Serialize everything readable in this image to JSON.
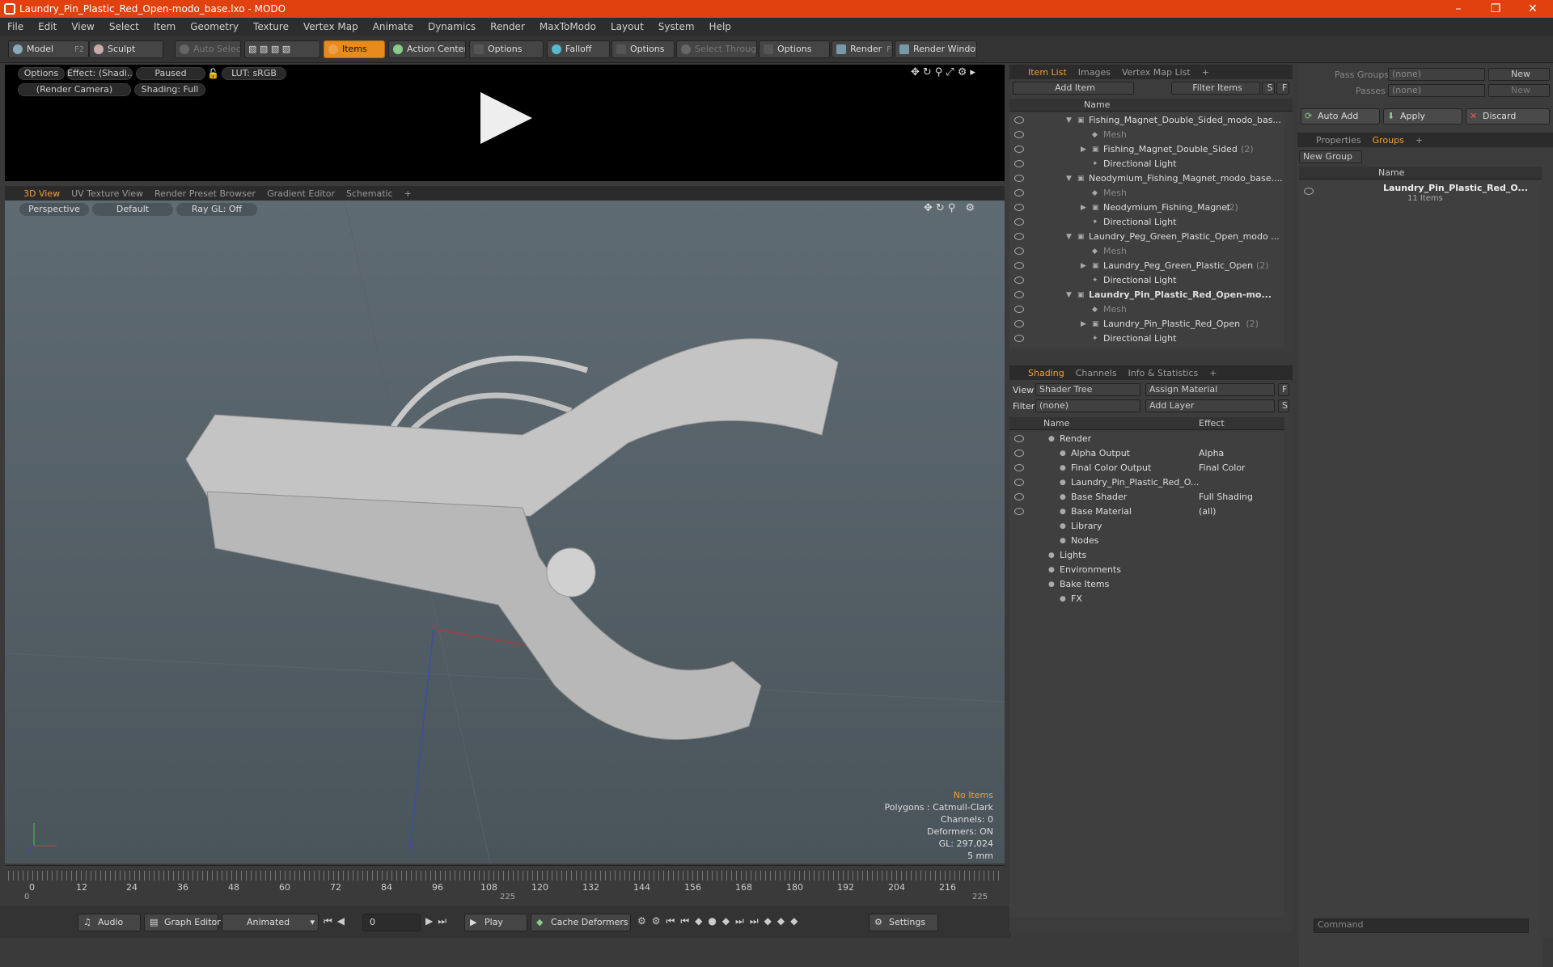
{
  "window": {
    "title": "Laundry_Pin_Plastic_Red_Open-modo_base.lxo - MODO",
    "minimize": "–",
    "maximize": "❐",
    "close": "✕"
  },
  "menu": [
    "File",
    "Edit",
    "View",
    "Select",
    "Item",
    "Geometry",
    "Texture",
    "Vertex Map",
    "Animate",
    "Dynamics",
    "Render",
    "MaxToModo",
    "Layout",
    "System",
    "Help"
  ],
  "toolbar": {
    "model": "Model",
    "model_key": "F2",
    "sculpt": "Sculpt",
    "auto_select": "Auto Select",
    "items": "Items",
    "action_center": "Action Center",
    "options1": "Options",
    "falloff": "Falloff",
    "options2": "Options",
    "select_through": "Select Through",
    "options3": "Options",
    "render": "Render",
    "render_key": "F9",
    "render_window": "Render Window"
  },
  "preview": {
    "options": "Options",
    "effect": "Effect: (Shadi...",
    "paused": "Paused",
    "lut": "LUT: sRGB",
    "camera": "(Render Camera)",
    "shading": "Shading: Full"
  },
  "viewtabs": [
    "3D View",
    "UV Texture View",
    "Render Preset Browser",
    "Gradient Editor",
    "Schematic",
    "+"
  ],
  "viewport": {
    "perspective": "Perspective",
    "default": "Default",
    "raygl": "Ray GL: Off",
    "info": {
      "noitems": "No Items",
      "polygons": "Polygons : Catmull-Clark",
      "channels": "Channels: 0",
      "deformers": "Deformers: ON",
      "gl": "GL: 297,024",
      "scale": "5 mm"
    }
  },
  "timeline": {
    "ticks": [
      "0",
      "12",
      "24",
      "36",
      "48",
      "60",
      "72",
      "84",
      "96",
      "108",
      "120",
      "132",
      "144",
      "156",
      "168",
      "180",
      "192",
      "204",
      "216"
    ],
    "start": "0",
    "mid": "225",
    "end": "225"
  },
  "bottom": {
    "audio": "Audio",
    "graph": "Graph Editor",
    "animated": "Animated",
    "frame": "0",
    "play": "Play",
    "cache": "Cache Deformers",
    "settings": "Settings"
  },
  "itemlist": {
    "tabs": [
      "Item List",
      "Images",
      "Vertex Map List",
      "+"
    ],
    "add_item": "Add Item",
    "filter": "Filter Items",
    "s": "S",
    "f": "F",
    "col_name": "Name",
    "rows": [
      {
        "t": "Fishing_Magnet_Double_Sided_modo_bas...",
        "lvl": 0,
        "kind": "scene"
      },
      {
        "t": "Mesh",
        "lvl": 1,
        "kind": "mesh"
      },
      {
        "t": "Fishing_Magnet_Double_Sided",
        "c": "(2)",
        "lvl": 1,
        "kind": "group"
      },
      {
        "t": "Directional Light",
        "lvl": 1,
        "kind": "light"
      },
      {
        "t": "Neodymium_Fishing_Magnet_modo_base....",
        "lvl": 0,
        "kind": "scene"
      },
      {
        "t": "Mesh",
        "lvl": 1,
        "kind": "mesh"
      },
      {
        "t": "Neodymium_Fishing_Magnet",
        "c": "(2)",
        "lvl": 1,
        "kind": "group"
      },
      {
        "t": "Directional Light",
        "lvl": 1,
        "kind": "light"
      },
      {
        "t": "Laundry_Peg_Green_Plastic_Open_modo ...",
        "lvl": 0,
        "kind": "scene"
      },
      {
        "t": "Mesh",
        "lvl": 1,
        "kind": "mesh"
      },
      {
        "t": "Laundry_Peg_Green_Plastic_Open",
        "c": "(2)",
        "lvl": 1,
        "kind": "group"
      },
      {
        "t": "Directional Light",
        "lvl": 1,
        "kind": "light"
      },
      {
        "t": "Laundry_Pin_Plastic_Red_Open-mo...",
        "lvl": 0,
        "kind": "scene",
        "bold": true
      },
      {
        "t": "Mesh",
        "lvl": 1,
        "kind": "mesh"
      },
      {
        "t": "Laundry_Pin_Plastic_Red_Open",
        "c": "(2)",
        "lvl": 1,
        "kind": "group"
      },
      {
        "t": "Directional Light",
        "lvl": 1,
        "kind": "light"
      }
    ]
  },
  "shading": {
    "tabs": [
      "Shading",
      "Channels",
      "Info & Statistics",
      "+"
    ],
    "view_lbl": "View",
    "view": "Shader Tree",
    "assign": "Assign Material",
    "f": "F",
    "filter_lbl": "Filter",
    "filter": "(none)",
    "add_layer": "Add Layer",
    "s": "S",
    "col_name": "Name",
    "col_effect": "Effect",
    "rows": [
      {
        "t": "Render",
        "e": "",
        "lvl": 0
      },
      {
        "t": "Alpha Output",
        "e": "Alpha",
        "lvl": 1
      },
      {
        "t": "Final Color Output",
        "e": "Final Color",
        "lvl": 1
      },
      {
        "t": "Laundry_Pin_Plastic_Red_O...",
        "e": "",
        "lvl": 1
      },
      {
        "t": "Base Shader",
        "e": "Full Shading",
        "lvl": 1
      },
      {
        "t": "Base Material",
        "e": "(all)",
        "lvl": 1
      },
      {
        "t": "Library",
        "e": "",
        "lvl": 1
      },
      {
        "t": "Nodes",
        "e": "",
        "lvl": 1
      },
      {
        "t": "Lights",
        "e": "",
        "lvl": 0
      },
      {
        "t": "Environments",
        "e": "",
        "lvl": 0
      },
      {
        "t": "Bake Items",
        "e": "",
        "lvl": 0
      },
      {
        "t": "FX",
        "e": "",
        "lvl": 1
      }
    ]
  },
  "right": {
    "pass_groups": "Pass Groups",
    "passes": "Passes",
    "none1": "(none)",
    "none2": "(none)",
    "new1": "New",
    "new2": "New",
    "auto_add": "Auto Add",
    "apply": "Apply",
    "discard": "Discard",
    "tabs": [
      "Properties",
      "Groups",
      "+"
    ],
    "new_group": "New Group",
    "col_name": "Name",
    "group_name": "Laundry_Pin_Plastic_Red_O...",
    "group_count": "11 Items",
    "command": "Command"
  },
  "colors": {
    "accent": "#f0a030",
    "title": "#e0410f"
  }
}
